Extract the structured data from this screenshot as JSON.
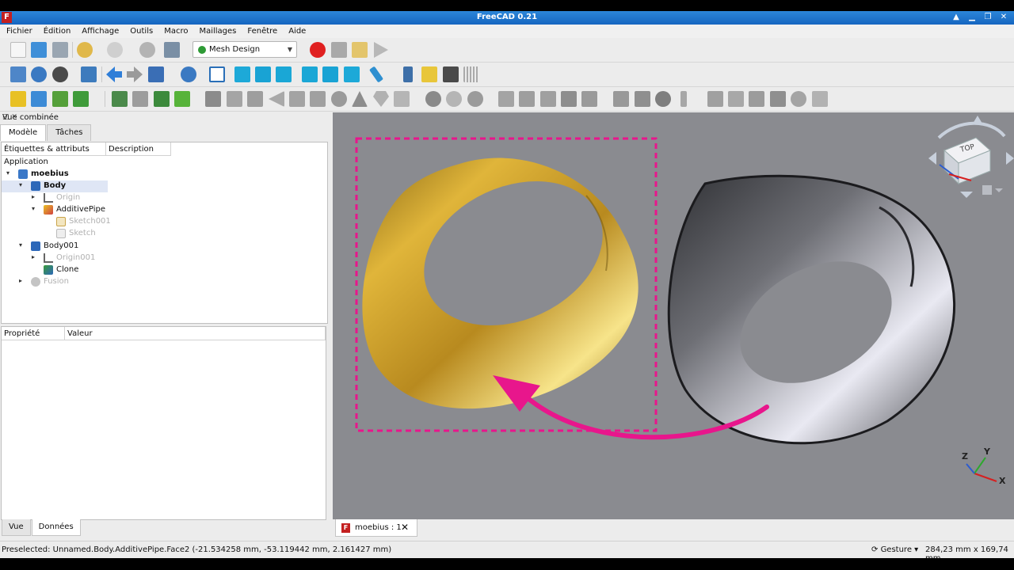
{
  "window": {
    "title": "FreeCAD 0.21",
    "app_icon": "F"
  },
  "menu": [
    "Fichier",
    "Édition",
    "Affichage",
    "Outils",
    "Macro",
    "Maillages",
    "Fenêtre",
    "Aide"
  ],
  "workbench": {
    "selected": "Mesh Design"
  },
  "combo_view": {
    "title": "Vue combinée",
    "tabs": [
      "Modèle",
      "Tâches"
    ],
    "tree_headers": [
      "Étiquettes & attributs",
      "Description"
    ],
    "application_label": "Application",
    "tree": {
      "doc": "moebius",
      "body": "Body",
      "origin": "Origin",
      "additive_pipe": "AdditivePipe",
      "sketch001": "Sketch001",
      "sketch": "Sketch",
      "body001": "Body001",
      "origin001": "Origin001",
      "clone": "Clone",
      "fusion": "Fusion"
    },
    "prop_headers": [
      "Propriété",
      "Valeur"
    ],
    "bottom_tabs": [
      "Vue",
      "Données"
    ]
  },
  "navcube": {
    "face_label": "TOP"
  },
  "axes": {
    "x": "X",
    "y": "Y",
    "z": "Z"
  },
  "document_tab": {
    "label": "moebius : 1",
    "close": "✕"
  },
  "status": {
    "message": "Preselected: Unnamed.Body.AdditivePipe.Face2 (-21.534258 mm, -53.119442 mm, 2.161427 mm)",
    "navigation_style": "Gesture",
    "dimensions": "284,23 mm x 169,74 mm"
  },
  "colors": {
    "highlight": "#e8168c",
    "viewport_bg": "#8a8b90",
    "gold": "#d4a72a"
  }
}
